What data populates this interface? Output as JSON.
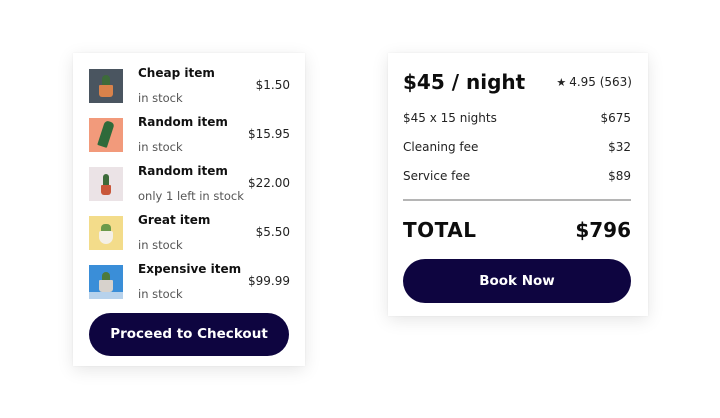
{
  "cart": {
    "items": [
      {
        "name": "Cheap item",
        "stock": "in stock",
        "price": "$1.50",
        "thumb_bg": "#4a5560",
        "pot_color": "#d9824b"
      },
      {
        "name": "Random item",
        "stock": "in stock",
        "price": "$15.95",
        "thumb_bg": "#f29a7b",
        "pot_color": "#f29a7b"
      },
      {
        "name": "Random item",
        "stock": "only 1 left in stock",
        "price": "$22.00",
        "thumb_bg": "#ebe3e6",
        "pot_color": "#c9573a"
      },
      {
        "name": "Great item",
        "stock": "in stock",
        "price": "$5.50",
        "thumb_bg": "#f3dc8a",
        "pot_color": "#f4f0e6"
      },
      {
        "name": "Expensive item",
        "stock": "in stock",
        "price": "$99.99",
        "thumb_bg": "#3a8ed8",
        "pot_color": "#d7d2cc"
      }
    ],
    "checkout_label": "Proceed to Checkout"
  },
  "booking": {
    "price_per_night": "$45 / night",
    "rating": "4.95 (563)",
    "rows": [
      {
        "label": "$45 x 15 nights",
        "value": "$675"
      },
      {
        "label": "Cleaning fee",
        "value": "$32"
      },
      {
        "label": "Service fee",
        "value": "$89"
      }
    ],
    "total_label": "TOTAL",
    "total_value": "$796",
    "book_label": "Book Now"
  },
  "colors": {
    "button_bg": "#0e0540",
    "button_text": "#ffffff",
    "divider": "#b5b5b5"
  }
}
